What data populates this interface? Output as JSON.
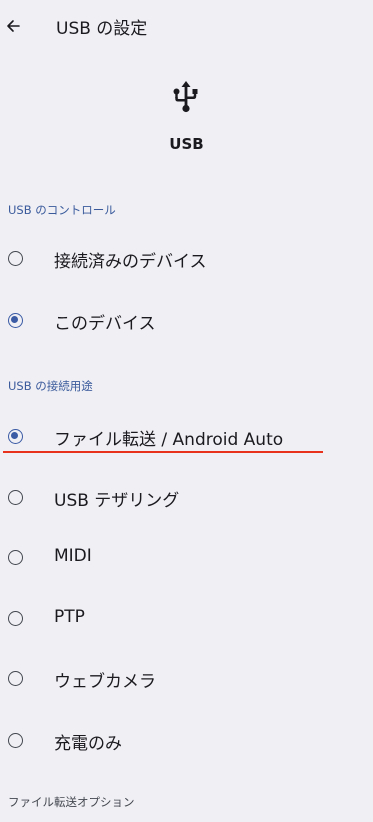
{
  "header": {
    "title": "USB の設定",
    "back_icon": "arrow-back-icon"
  },
  "hero": {
    "icon": "usb-icon",
    "label": "USB"
  },
  "sections": {
    "control": {
      "title": "USB のコントロール",
      "options": [
        {
          "label": "接続済みのデバイス",
          "selected": false
        },
        {
          "label": "このデバイス",
          "selected": true
        }
      ]
    },
    "purpose": {
      "title": "USB の接続用途",
      "options": [
        {
          "label": "ファイル転送 / Android Auto",
          "selected": true
        },
        {
          "label": "USB テザリング",
          "selected": false
        },
        {
          "label": "MIDI",
          "selected": false
        },
        {
          "label": "PTP",
          "selected": false
        },
        {
          "label": "ウェブカメラ",
          "selected": false
        },
        {
          "label": "充電のみ",
          "selected": false
        }
      ]
    },
    "file_transfer_options": {
      "title": "ファイル転送オプション"
    }
  },
  "colors": {
    "background": "#efeff4",
    "accent": "#3b5ba5",
    "annotation_underline": "#e8321c"
  }
}
